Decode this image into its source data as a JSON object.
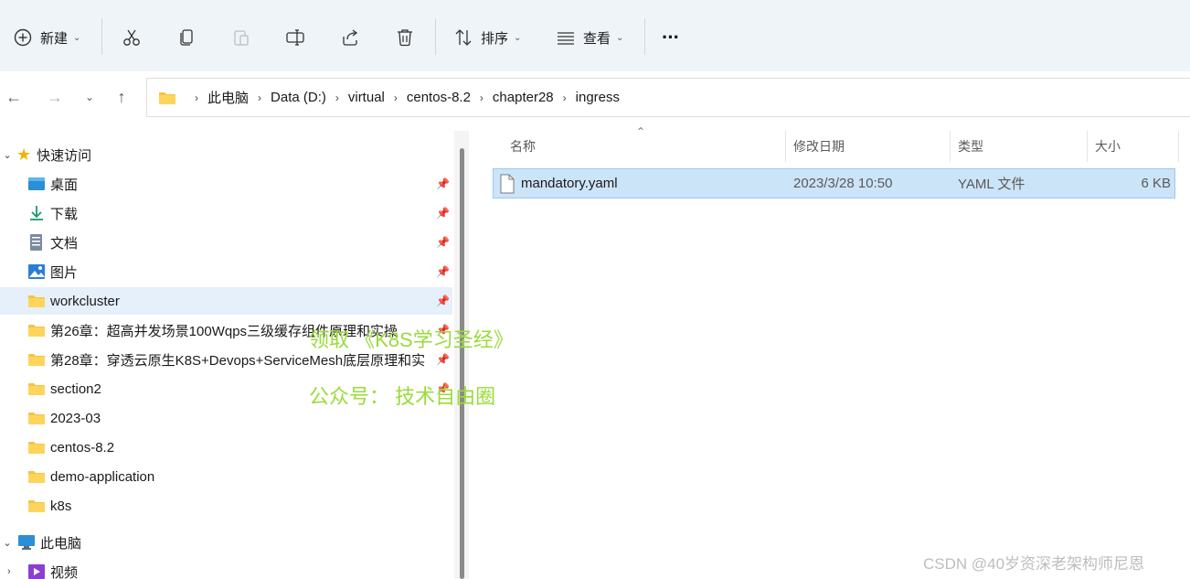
{
  "toolbar": {
    "new_label": "新建",
    "sort_label": "排序",
    "view_label": "查看",
    "more_label": "···"
  },
  "address": {
    "crumbs": [
      "此电脑",
      "Data (D:)",
      "virtual",
      "centos-8.2",
      "chapter28",
      "ingress"
    ]
  },
  "sidebar": {
    "quick_access": "快速访问",
    "items": [
      {
        "label": "桌面",
        "icon": "desktop-icon",
        "pinned": true
      },
      {
        "label": "下载",
        "icon": "download-icon",
        "pinned": true
      },
      {
        "label": "文档",
        "icon": "document-icon",
        "pinned": true
      },
      {
        "label": "图片",
        "icon": "picture-icon",
        "pinned": true
      },
      {
        "label": "workcluster",
        "icon": "folder-icon",
        "pinned": true
      },
      {
        "label": "第26章：超高并发场景100Wqps三级缓存组件原理和实操",
        "icon": "folder-icon",
        "pinned": true
      },
      {
        "label": "第28章：穿透云原生K8S+Devops+ServiceMesh底层原理和实",
        "icon": "folder-icon",
        "pinned": true
      },
      {
        "label": "section2",
        "icon": "folder-icon",
        "pinned": true
      },
      {
        "label": "2023-03",
        "icon": "folder-icon",
        "pinned": false
      },
      {
        "label": "centos-8.2",
        "icon": "folder-icon",
        "pinned": false
      },
      {
        "label": "demo-application",
        "icon": "folder-icon",
        "pinned": false
      },
      {
        "label": "k8s",
        "icon": "folder-icon",
        "pinned": false
      }
    ],
    "this_pc": "此电脑",
    "videos": "视频"
  },
  "columns": {
    "name": "名称",
    "modified": "修改日期",
    "type": "类型",
    "size": "大小"
  },
  "files": [
    {
      "name": "mandatory.yaml",
      "modified": "2023/3/28 10:50",
      "type": "YAML 文件",
      "size": "6 KB"
    }
  ],
  "watermark": {
    "line1": "领取 《K8S学习圣经》",
    "line2": "公众号： 技术自由圈",
    "csdn": "CSDN @40岁资深老架构师尼恩"
  },
  "colors": {
    "toolbar_bg": "#eff4f9",
    "selection_bg": "#cce4f7",
    "folder": "#f5c342",
    "watermark": "#9adb3a"
  }
}
